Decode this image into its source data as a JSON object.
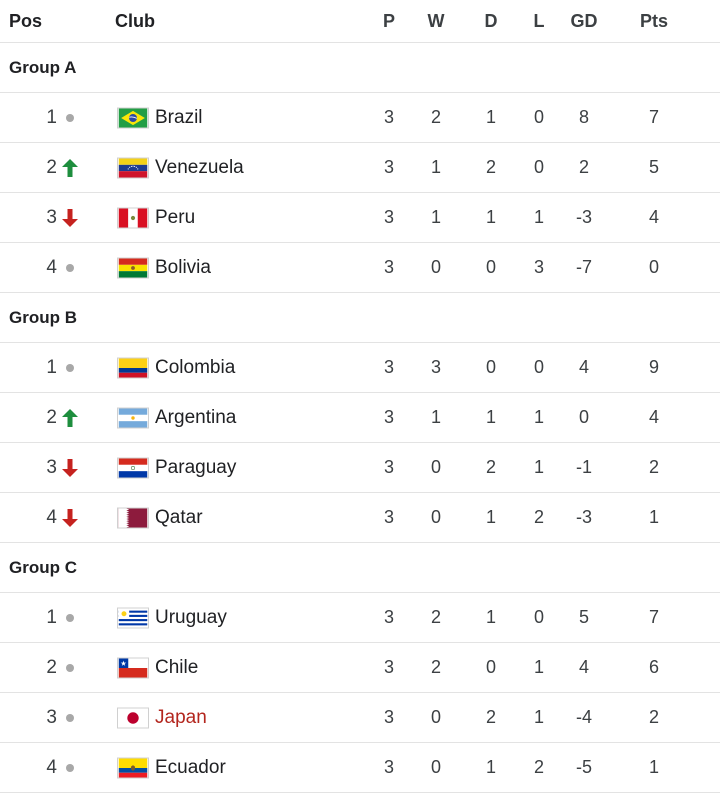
{
  "headers": {
    "pos": "Pos",
    "club": "Club",
    "p": "P",
    "w": "W",
    "d": "D",
    "l": "L",
    "gd": "GD",
    "pts": "Pts"
  },
  "colors": {
    "up": "#1e8e3e",
    "down": "#c5221f",
    "neutral": "#a8a8a8",
    "highlight": "#b3261e"
  },
  "groups": [
    {
      "name": "Group A",
      "teams": [
        {
          "pos": "1",
          "trend": "neutral",
          "flag": "brazil-flag-icon",
          "club": "Brazil",
          "p": "3",
          "w": "2",
          "d": "1",
          "l": "0",
          "gd": "8",
          "pts": "7"
        },
        {
          "pos": "2",
          "trend": "up",
          "flag": "venezuela-flag-icon",
          "club": "Venezuela",
          "p": "3",
          "w": "1",
          "d": "2",
          "l": "0",
          "gd": "2",
          "pts": "5"
        },
        {
          "pos": "3",
          "trend": "down",
          "flag": "peru-flag-icon",
          "club": "Peru",
          "p": "3",
          "w": "1",
          "d": "1",
          "l": "1",
          "gd": "-3",
          "pts": "4"
        },
        {
          "pos": "4",
          "trend": "neutral",
          "flag": "bolivia-flag-icon",
          "club": "Bolivia",
          "p": "3",
          "w": "0",
          "d": "0",
          "l": "3",
          "gd": "-7",
          "pts": "0"
        }
      ]
    },
    {
      "name": "Group B",
      "teams": [
        {
          "pos": "1",
          "trend": "neutral",
          "flag": "colombia-flag-icon",
          "club": "Colombia",
          "p": "3",
          "w": "3",
          "d": "0",
          "l": "0",
          "gd": "4",
          "pts": "9"
        },
        {
          "pos": "2",
          "trend": "up",
          "flag": "argentina-flag-icon",
          "club": "Argentina",
          "p": "3",
          "w": "1",
          "d": "1",
          "l": "1",
          "gd": "0",
          "pts": "4"
        },
        {
          "pos": "3",
          "trend": "down",
          "flag": "paraguay-flag-icon",
          "club": "Paraguay",
          "p": "3",
          "w": "0",
          "d": "2",
          "l": "1",
          "gd": "-1",
          "pts": "2"
        },
        {
          "pos": "4",
          "trend": "down",
          "flag": "qatar-flag-icon",
          "club": "Qatar",
          "p": "3",
          "w": "0",
          "d": "1",
          "l": "2",
          "gd": "-3",
          "pts": "1"
        }
      ]
    },
    {
      "name": "Group C",
      "teams": [
        {
          "pos": "1",
          "trend": "neutral",
          "flag": "uruguay-flag-icon",
          "club": "Uruguay",
          "p": "3",
          "w": "2",
          "d": "1",
          "l": "0",
          "gd": "5",
          "pts": "7"
        },
        {
          "pos": "2",
          "trend": "neutral",
          "flag": "chile-flag-icon",
          "club": "Chile",
          "p": "3",
          "w": "2",
          "d": "0",
          "l": "1",
          "gd": "4",
          "pts": "6"
        },
        {
          "pos": "3",
          "trend": "neutral",
          "flag": "japan-flag-icon",
          "club": "Japan",
          "highlight": true,
          "p": "3",
          "w": "0",
          "d": "2",
          "l": "1",
          "gd": "-4",
          "pts": "2"
        },
        {
          "pos": "4",
          "trend": "neutral",
          "flag": "ecuador-flag-icon",
          "club": "Ecuador",
          "p": "3",
          "w": "0",
          "d": "1",
          "l": "2",
          "gd": "-5",
          "pts": "1"
        }
      ]
    }
  ]
}
